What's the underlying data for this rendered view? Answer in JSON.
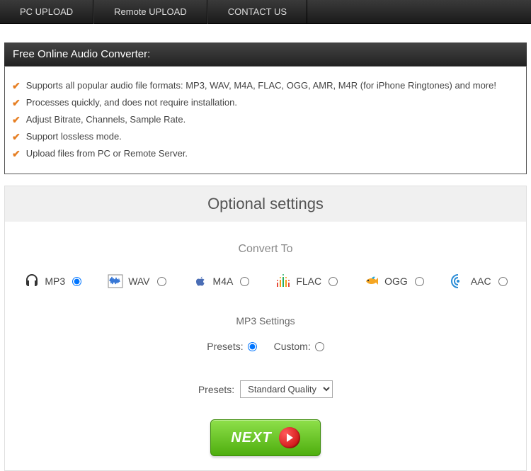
{
  "nav": {
    "items": [
      "PC UPLOAD",
      "Remote UPLOAD",
      "CONTACT US"
    ]
  },
  "header": "Free Online Audio Converter:",
  "features": [
    "Supports all popular audio file formats: MP3, WAV, M4A, FLAC, OGG, AMR, M4R (for iPhone Ringtones) and more!",
    "Processes quickly, and does not require installation.",
    "Adjust Bitrate, Channels, Sample Rate.",
    "Support lossless mode.",
    "Upload files from PC or Remote Server."
  ],
  "settings": {
    "title": "Optional settings",
    "convert_label": "Convert To",
    "formats": [
      "MP3",
      "WAV",
      "M4A",
      "FLAC",
      "OGG",
      "AAC"
    ],
    "sub_label": "MP3 Settings",
    "mode_presets": "Presets:",
    "mode_custom": "Custom:",
    "preset_label": "Presets:",
    "preset_value": "Standard Quality",
    "next": "NEXT"
  }
}
